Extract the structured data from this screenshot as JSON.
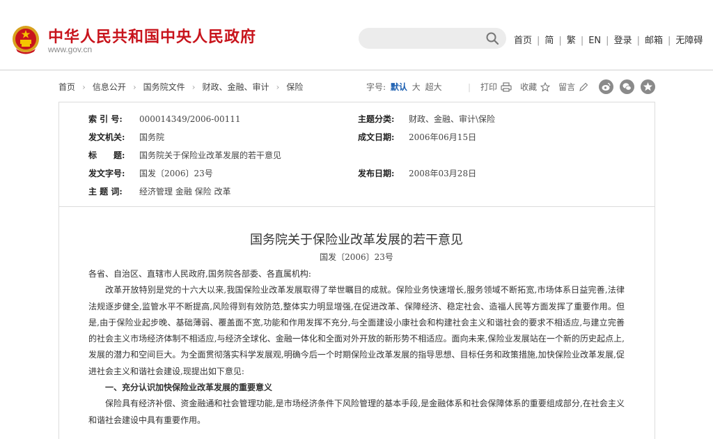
{
  "header": {
    "site_title": "中华人民共和国中央人民政府",
    "site_url": "www.gov.cn",
    "search_placeholder": "",
    "nav": [
      "首页",
      "简",
      "繁",
      "EN",
      "登录",
      "邮箱",
      "无障碍"
    ]
  },
  "breadcrumb": [
    "首页",
    "信息公开",
    "国务院文件",
    "财政、金融、审计",
    "保险"
  ],
  "font_size": {
    "label": "字号:",
    "options": [
      "默认",
      "大",
      "超大"
    ],
    "active": "默认"
  },
  "tools": {
    "print": "打印",
    "favorite": "收藏",
    "comment": "留言"
  },
  "share_icons": [
    "weibo-icon",
    "wechat-icon",
    "qzone-icon"
  ],
  "info": {
    "index_label": "索 引 号:",
    "index_value": "000014349/2006-00111",
    "category_label": "主题分类:",
    "category_value": "财政、金融、审计\\保险",
    "issuer_label": "发文机关:",
    "issuer_value": "国务院",
    "written_label": "成文日期:",
    "written_value": "2006年06月15日",
    "title_label": "标　　题:",
    "title_value": "国务院关于保险业改革发展的若干意见",
    "docno_label": "发文字号:",
    "docno_value": "国发〔2006〕23号",
    "published_label": "发布日期:",
    "published_value": "2008年03月28日",
    "keywords_label": "主 题 词:",
    "keywords_value": "经济管理 金融 保险 改革"
  },
  "article": {
    "title": "国务院关于保险业改革发展的若干意见",
    "doc_number": "国发〔2006〕23号",
    "salutation": "各省、自治区、直辖市人民政府,国务院各部委、各直属机构:",
    "para1": "改革开放特别是党的十六大以来,我国保险业改革发展取得了举世瞩目的成就。保险业务快速增长,服务领域不断拓宽,市场体系日益完善,法律法规逐步健全,监管水平不断提高,风险得到有效防范,整体实力明显增强,在促进改革、保障经济、稳定社会、造福人民等方面发挥了重要作用。但是,由于保险业起步晚、基础薄弱、覆盖面不宽,功能和作用发挥不充分,与全面建设小康社会和构建社会主义和谐社会的要求不相适应,与建立完善的社会主义市场经济体制不相适应,与经济全球化、金融一体化和全面对外开放的新形势不相适应。面向未来,保险业发展站在一个新的历史起点上,发展的潜力和空间巨大。为全面贯彻落实科学发展观,明确今后一个时期保险业改革发展的指导思想、目标任务和政策措施,加快保险业改革发展,促进社会主义和谐社会建设,现提出如下意见:",
    "heading1": "一、充分认识加快保险业改革发展的重要意义",
    "para2": "保险具有经济补偿、资金融通和社会管理功能,是市场经济条件下风险管理的基本手段,是金融体系和社会保障体系的重要组成部分,在社会主义和谐社会建设中具有重要作用。"
  },
  "colors": {
    "brand_red": "#c8141c",
    "link_blue": "#1a5eb0",
    "border": "#dcdcdc"
  }
}
